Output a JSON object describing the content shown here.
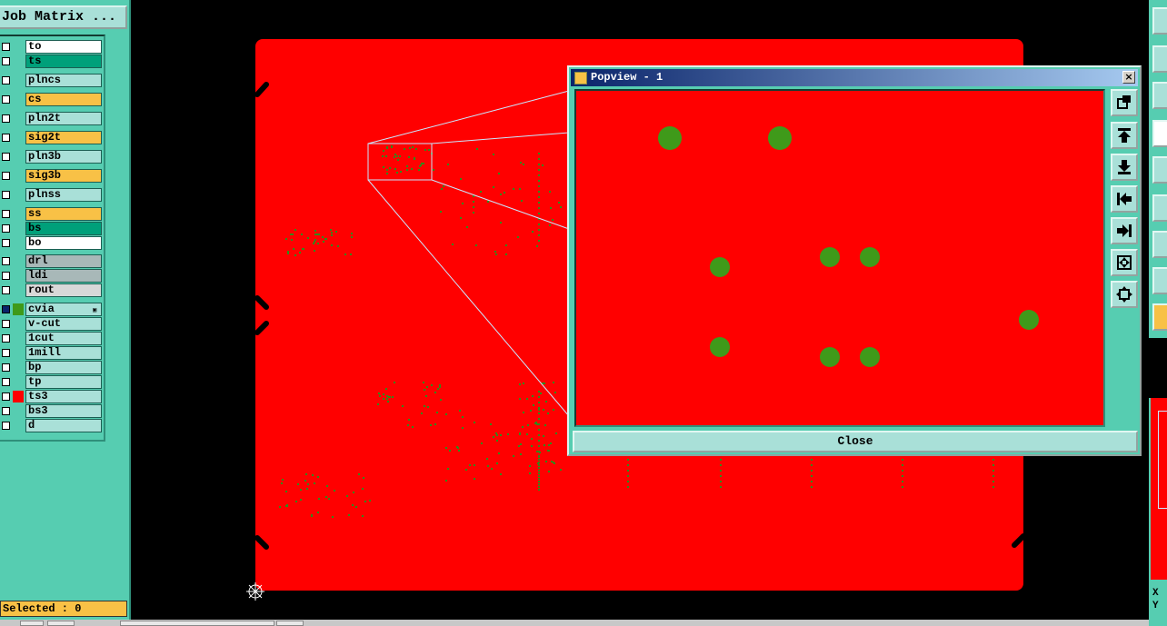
{
  "left_panel": {
    "job_matrix_label": "Job Matrix ...",
    "layers": [
      {
        "name": "to",
        "color": "#ffffff"
      },
      {
        "name": "ts",
        "color": "#00a07a"
      },
      {
        "name": "plncs",
        "color": "#a9e0d8"
      },
      {
        "name": "cs",
        "color": "#f8c146"
      },
      {
        "name": "pln2t",
        "color": "#a9e0d8"
      },
      {
        "name": "sig2t",
        "color": "#f8c146"
      },
      {
        "name": "pln3b",
        "color": "#a9e0d8"
      },
      {
        "name": "sig3b",
        "color": "#f8c146"
      },
      {
        "name": "plnss",
        "color": "#a9e0d8"
      },
      {
        "name": "ss",
        "color": "#f8c146"
      },
      {
        "name": "bs",
        "color": "#00a07a"
      },
      {
        "name": "bo",
        "color": "#ffffff"
      },
      {
        "name": "drl",
        "color": "#a8b8b8"
      },
      {
        "name": "ldi",
        "color": "#a8b8b8"
      },
      {
        "name": "rout",
        "color": "#d8d8d8"
      },
      {
        "name": "cvia",
        "color": "#a9e0d8",
        "swatch": "#3f9a1a",
        "active": true
      },
      {
        "name": "v-cut",
        "color": "#a9e0d8"
      },
      {
        "name": "1cut",
        "color": "#a9e0d8"
      },
      {
        "name": "1mill",
        "color": "#a9e0d8"
      },
      {
        "name": "bp",
        "color": "#a9e0d8"
      },
      {
        "name": "tp",
        "color": "#a9e0d8"
      },
      {
        "name": "ts3",
        "color": "#a9e0d8",
        "swatch": "#ff0000"
      },
      {
        "name": "bs3",
        "color": "#a9e0d8"
      },
      {
        "name": "d",
        "color": "#a9e0d8"
      }
    ],
    "selected_status": "Selected : 0"
  },
  "popview": {
    "title": "Popview - 1",
    "close_button_label": "Close",
    "close_x": "×",
    "pad_color": "#3f9a1a",
    "tools": [
      "zoom-home-icon",
      "pan-up-icon",
      "pan-down-icon",
      "pan-left-icon",
      "pan-right-icon",
      "fit-all-icon",
      "zoom-center-icon"
    ]
  },
  "board": {
    "background": "#ff0000",
    "pad_color": "#2e8b1c"
  },
  "right_toolbar": {
    "coord_label_x": "X",
    "coord_label_y": "Y"
  }
}
